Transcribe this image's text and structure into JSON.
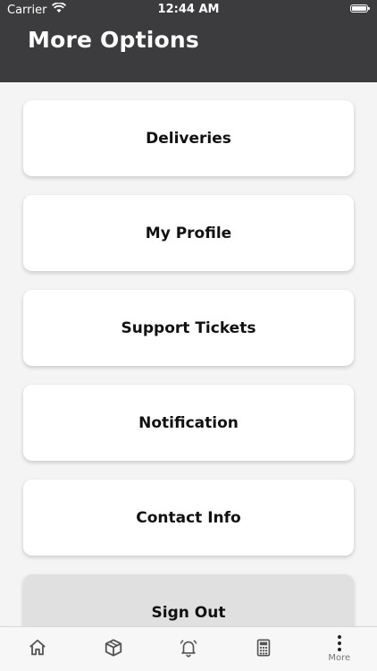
{
  "status_bar": {
    "carrier": "Carrier",
    "time": "12:44 AM"
  },
  "header": {
    "title": "More Options"
  },
  "menu": {
    "items": [
      {
        "label": "Deliveries"
      },
      {
        "label": "My Profile"
      },
      {
        "label": "Support Tickets"
      },
      {
        "label": "Notification"
      },
      {
        "label": "Contact Info"
      },
      {
        "label": "Sign Out"
      }
    ]
  },
  "tabbar": {
    "tabs": [
      {
        "icon": "home-icon"
      },
      {
        "icon": "box-icon"
      },
      {
        "icon": "bell-icon"
      },
      {
        "icon": "calculator-icon"
      },
      {
        "icon": "more-vertical-icon",
        "label": "More"
      }
    ]
  },
  "colors": {
    "header_bg": "#3c3c3e",
    "page_bg": "#f4f4f4",
    "card_bg": "#ffffff",
    "signout_bg": "#e0e0e0"
  }
}
